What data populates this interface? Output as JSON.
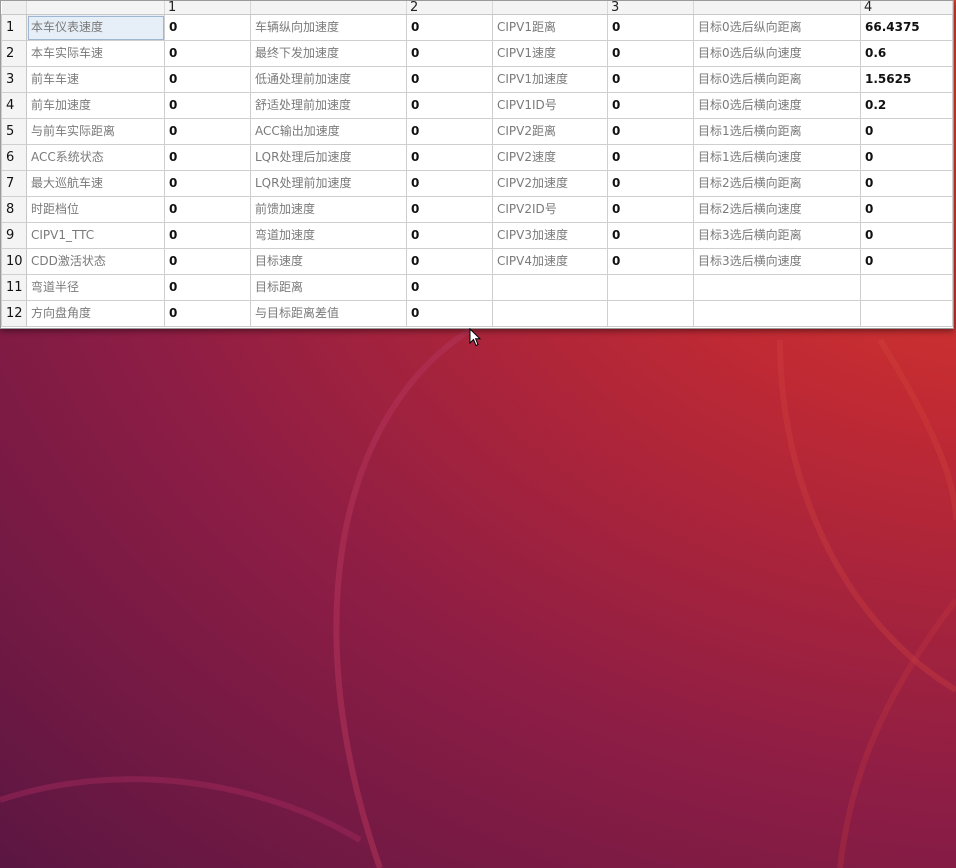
{
  "table": {
    "column_headers": [
      "",
      "1",
      "",
      "2",
      "",
      "3",
      "",
      "4"
    ],
    "rows": [
      {
        "num": "1",
        "cells": [
          "本车仪表速度",
          "0",
          "车辆纵向加速度",
          "0",
          "CIPV1距离",
          "0",
          "目标0选后纵向距离",
          "66.4375"
        ]
      },
      {
        "num": "2",
        "cells": [
          "本车实际车速",
          "0",
          "最终下发加速度",
          "0",
          "CIPV1速度",
          "0",
          "目标0选后纵向速度",
          "0.6"
        ]
      },
      {
        "num": "3",
        "cells": [
          "前车车速",
          "0",
          "低通处理前加速度",
          "0",
          "CIPV1加速度",
          "0",
          "目标0选后横向距离",
          "1.5625"
        ]
      },
      {
        "num": "4",
        "cells": [
          "前车加速度",
          "0",
          "舒适处理前加速度",
          "0",
          "CIPV1ID号",
          "0",
          "目标0选后横向速度",
          "0.2"
        ]
      },
      {
        "num": "5",
        "cells": [
          "与前车实际距离",
          "0",
          "ACC输出加速度",
          "0",
          "CIPV2距离",
          "0",
          "目标1选后横向距离",
          "0"
        ]
      },
      {
        "num": "6",
        "cells": [
          "ACC系统状态",
          "0",
          "LQR处理后加速度",
          "0",
          "CIPV2速度",
          "0",
          "目标1选后横向速度",
          "0"
        ]
      },
      {
        "num": "7",
        "cells": [
          "最大巡航车速",
          "0",
          "LQR处理前加速度",
          "0",
          "CIPV2加速度",
          "0",
          "目标2选后横向距离",
          "0"
        ]
      },
      {
        "num": "8",
        "cells": [
          "时距档位",
          "0",
          "前馈加速度",
          "0",
          "CIPV2ID号",
          "0",
          "目标2选后横向速度",
          "0"
        ]
      },
      {
        "num": "9",
        "cells": [
          "CIPV1_TTC",
          "0",
          "弯道加速度",
          "0",
          "CIPV3加速度",
          "0",
          "目标3选后横向距离",
          "0"
        ]
      },
      {
        "num": "10",
        "cells": [
          "CDD激活状态",
          "0",
          "目标速度",
          "0",
          "CIPV4加速度",
          "0",
          "目标3选后横向速度",
          "0"
        ]
      },
      {
        "num": "11",
        "cells": [
          "弯道半径",
          "0",
          "目标距离",
          "0",
          "",
          "",
          "",
          ""
        ]
      },
      {
        "num": "12",
        "cells": [
          "方向盘角度",
          "0",
          "与目标距离差值",
          "0",
          "",
          "",
          "",
          ""
        ]
      }
    ]
  },
  "cursor_icon": "arrow-pointer-icon"
}
